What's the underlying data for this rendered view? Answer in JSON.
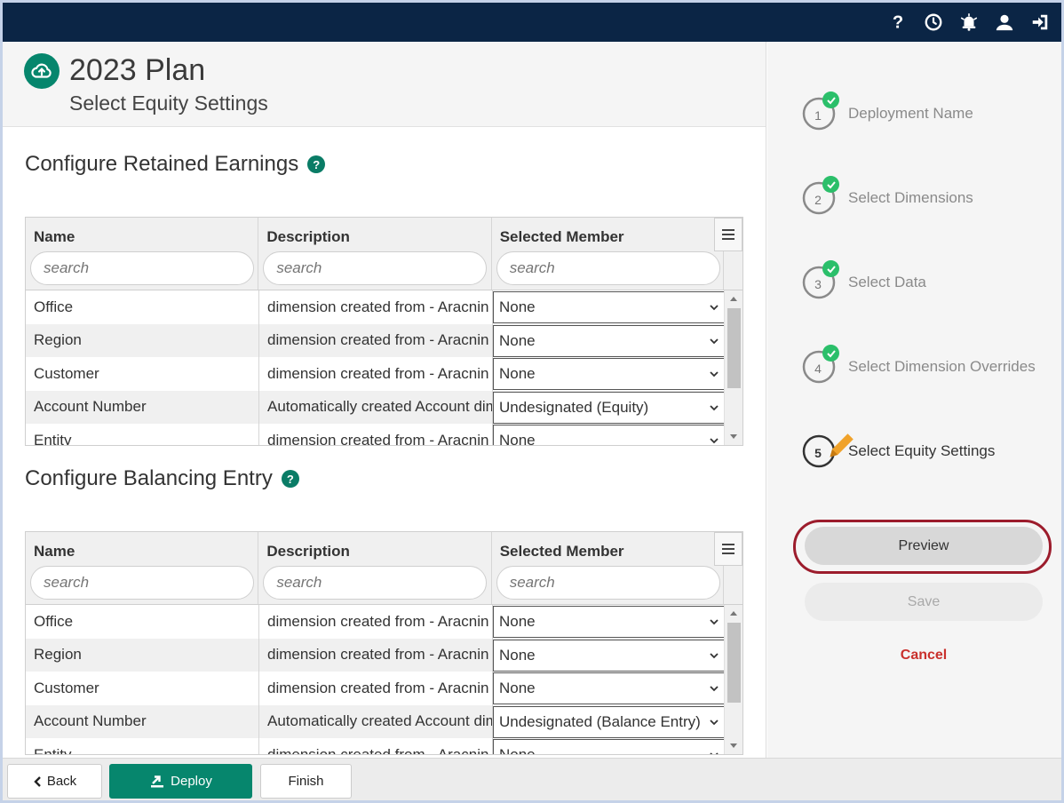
{
  "header": {
    "icons": [
      "help-icon",
      "history-icon",
      "alarm-icon",
      "user-icon",
      "logout-icon"
    ]
  },
  "page": {
    "title": "2023 Plan",
    "subtitle": "Select Equity Settings"
  },
  "retained_earnings": {
    "title": "Configure Retained Earnings",
    "help": "?",
    "columns": [
      "Name",
      "Description",
      "Selected Member"
    ],
    "search_placeholder": "search",
    "rows": [
      {
        "name": "Office",
        "description": "dimension created from - Aracnin",
        "member": "None"
      },
      {
        "name": "Region",
        "description": "dimension created from - Aracnin",
        "member": "None"
      },
      {
        "name": "Customer",
        "description": "dimension created from - Aracnin",
        "member": "None"
      },
      {
        "name": "Account Number",
        "description": "Automatically created Account dimension",
        "member": "Undesignated (Equity)"
      },
      {
        "name": "Entity",
        "description": "dimension created from - Aracnin",
        "member": "None"
      }
    ]
  },
  "balancing_entry": {
    "title": "Configure Balancing Entry",
    "help": "?",
    "columns": [
      "Name",
      "Description",
      "Selected Member"
    ],
    "search_placeholder": "search",
    "rows": [
      {
        "name": "Office",
        "description": "dimension created from - Aracnin",
        "member": "None"
      },
      {
        "name": "Region",
        "description": "dimension created from - Aracnin",
        "member": "None"
      },
      {
        "name": "Customer",
        "description": "dimension created from - Aracnin",
        "member": "None"
      },
      {
        "name": "Account Number",
        "description": "Automatically created Account dimension",
        "member": "Undesignated (Balance Entry)"
      },
      {
        "name": "Entity",
        "description": "dimension created from - Aracnin",
        "member": "None"
      }
    ]
  },
  "steps": [
    {
      "number": "1",
      "label": "Deployment Name",
      "status": "complete"
    },
    {
      "number": "2",
      "label": "Select Dimensions",
      "status": "complete"
    },
    {
      "number": "3",
      "label": "Select Data",
      "status": "complete"
    },
    {
      "number": "4",
      "label": "Select Dimension Overrides",
      "status": "complete"
    },
    {
      "number": "5",
      "label": "Select Equity Settings",
      "status": "active"
    }
  ],
  "actions": {
    "preview": "Preview",
    "save": "Save",
    "cancel": "Cancel"
  },
  "footer": {
    "back": "Back",
    "deploy": "Deploy",
    "finish": "Finish"
  },
  "colors": {
    "topbar": "#0b2545",
    "accent": "#06866d",
    "check": "#2bbf6a",
    "highlight_outline": "#9c1c2c",
    "cancel": "#c9302c"
  }
}
